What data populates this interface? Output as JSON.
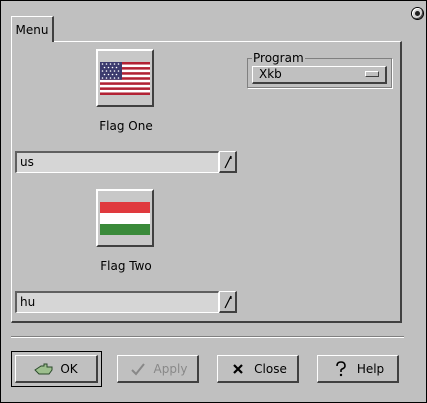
{
  "notebook": {
    "tab_label": "Menu"
  },
  "flag_one": {
    "caption": "Flag One",
    "flag_icon": "us-flag-icon",
    "layout_value": "us"
  },
  "flag_two": {
    "caption": "Flag Two",
    "flag_icon": "hungary-flag-icon",
    "layout_value": "hu"
  },
  "program": {
    "legend": "Program",
    "selected": "Xkb"
  },
  "buttons": {
    "ok": "OK",
    "apply": "Apply",
    "close": "Close",
    "help": "Help"
  },
  "colors": {
    "background": "#c0c0c0",
    "us_red": "#b22234",
    "us_blue": "#3c3b6e",
    "hu_red": "#e03a3e",
    "hu_green": "#3a8a3a"
  }
}
